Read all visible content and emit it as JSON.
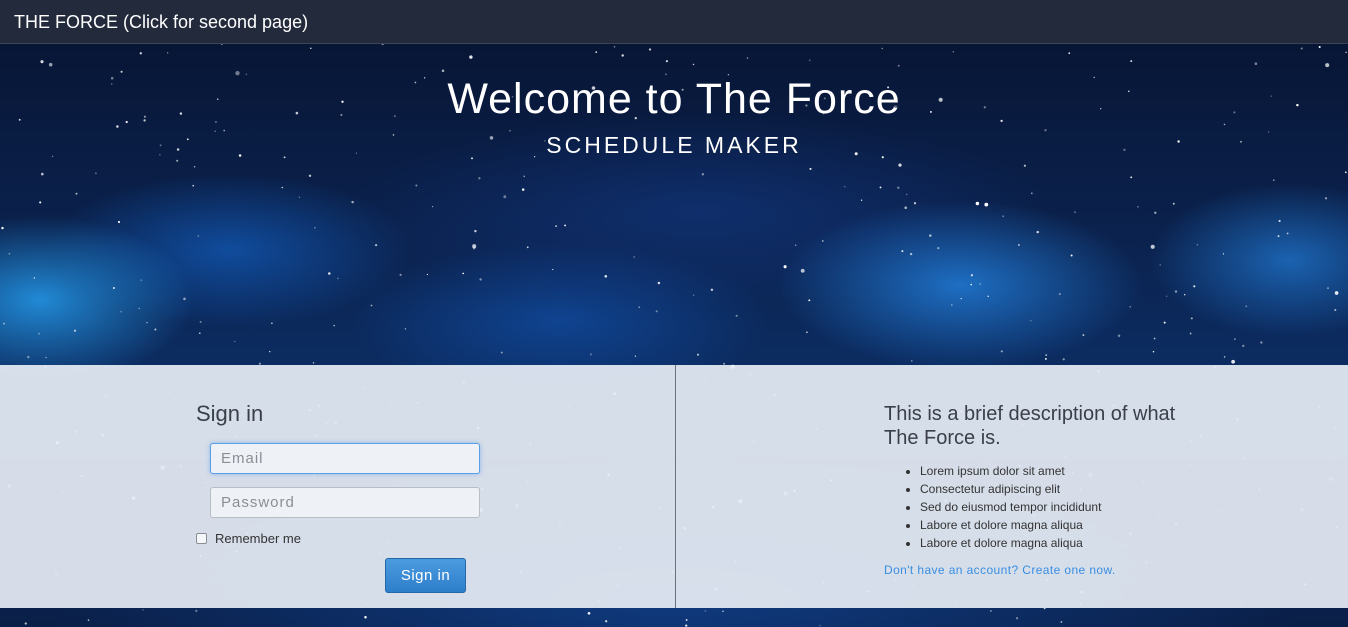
{
  "navbar": {
    "brand": "THE FORCE (Click for second page)"
  },
  "hero": {
    "title": "Welcome to The Force",
    "subtitle": "SCHEDULE MAKER"
  },
  "signin": {
    "title": "Sign in",
    "email_placeholder": "Email",
    "password_placeholder": "Password",
    "remember_label": "Remember me",
    "remember_checked": false,
    "button_label": "Sign in"
  },
  "description": {
    "title": "This is a brief description of what The Force is.",
    "items": [
      "Lorem ipsum dolor sit amet",
      "Consectetur adipiscing elit",
      "Sed do eiusmod tempor incididunt",
      "Labore et dolore magna aliqua",
      "Labore et dolore magna aliqua"
    ],
    "signup_link": "Don't have an account? Create one now."
  },
  "colors": {
    "navbar_bg": "#222a3b",
    "panel_bg": "#e6ecf4",
    "accent": "#2e7fca",
    "link": "#3a8ee0"
  }
}
